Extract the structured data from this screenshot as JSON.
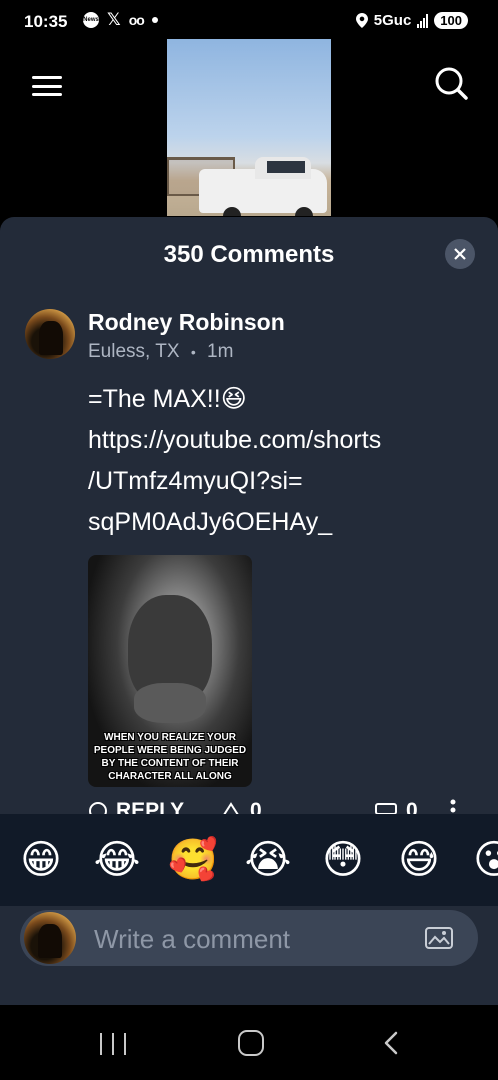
{
  "status_bar": {
    "time": "10:35",
    "news_badge": "News",
    "network": "5Guc",
    "battery": "100",
    "icons": [
      "news-icon",
      "x-icon",
      "voicemail-icon",
      "dot-icon",
      "location-icon",
      "signal-icon"
    ]
  },
  "header": {
    "menu_icon": "hamburger-menu-icon",
    "search_icon": "search-icon"
  },
  "comments_sheet": {
    "title": "350 Comments",
    "close_icon": "close-icon",
    "comment": {
      "author": "Rodney Robinson",
      "location": "Euless, TX",
      "separator": "•",
      "time": "1m",
      "text": "=The MAX!!😆\nhttps://youtube.com/shorts\n/UTmfz4myuQI?si=\nsqPM0AdJy6OEHAy_",
      "image_caption": "WHEN YOU REALIZE YOUR PEOPLE WERE BEING JUDGED BY THE CONTENT OF THEIR CHARACTER ALL ALONG",
      "reply_label": "REPLY",
      "upvotes": "0",
      "downvotes": "0"
    }
  },
  "emoji_bar": {
    "emojis": [
      "😁",
      "😂",
      "🥰",
      "😭",
      "😳",
      "😅",
      "😮"
    ]
  },
  "composer": {
    "placeholder": "Write a comment",
    "image_icon": "image-icon"
  },
  "nav_bar": {
    "icons": [
      "recent-apps-icon",
      "home-icon",
      "back-icon"
    ]
  },
  "colors": {
    "sheet_bg": "#232b39",
    "emoji_bar_bg": "#111a28",
    "composer_bg": "#3b4556",
    "meta_text": "#aeb6c3"
  }
}
